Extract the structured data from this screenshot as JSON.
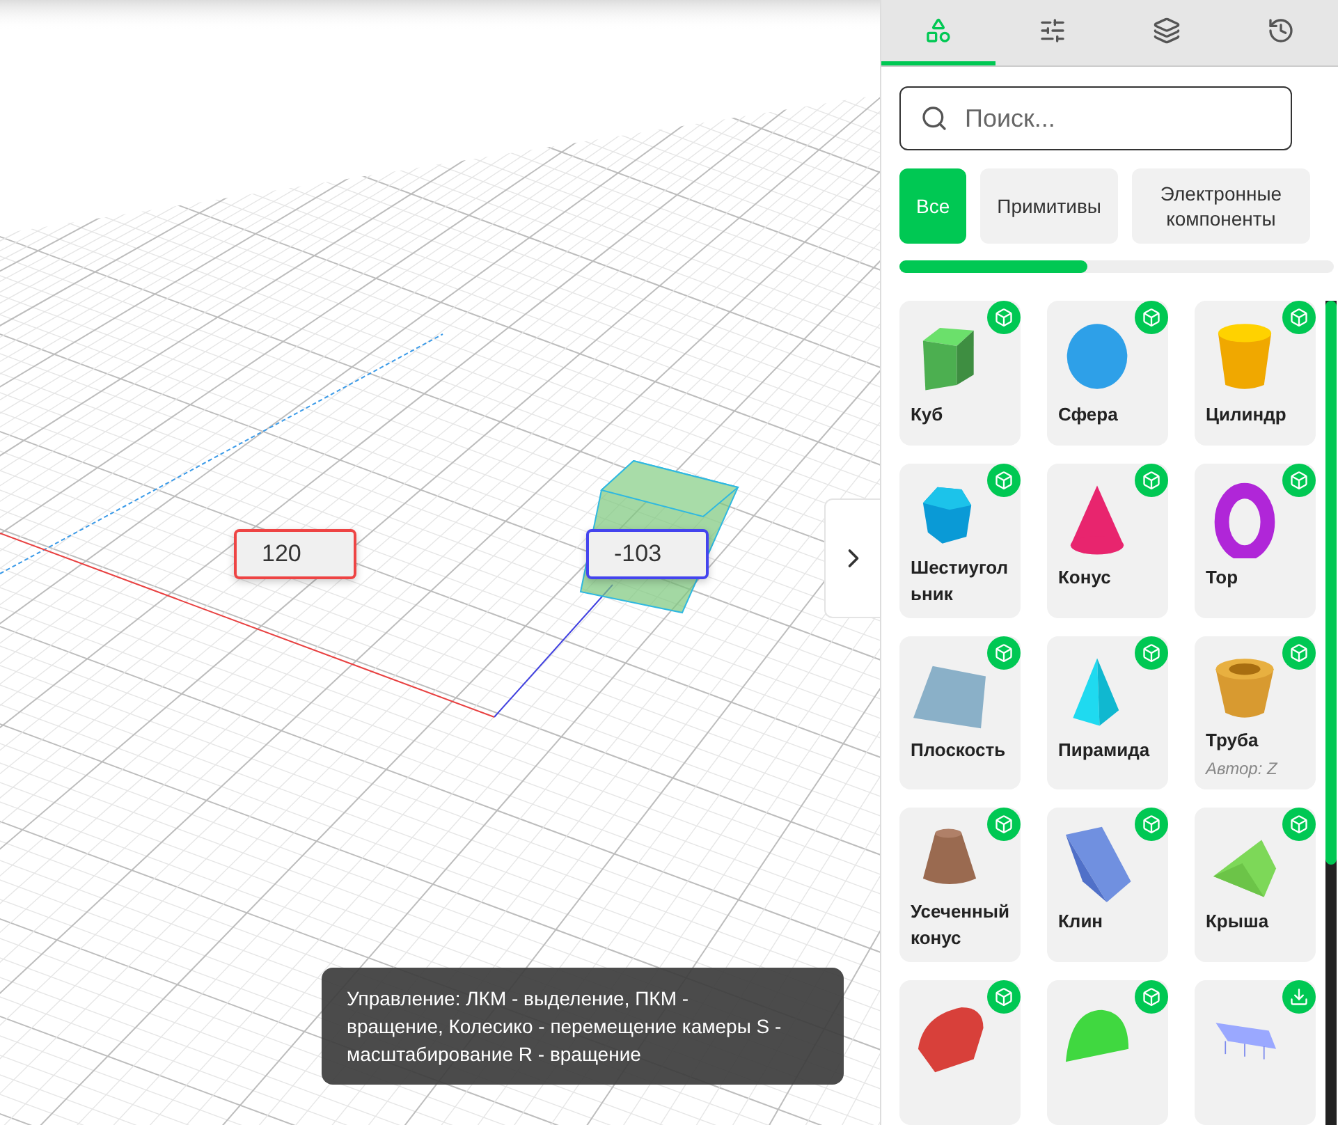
{
  "viewport": {
    "dimension_inputs": [
      {
        "value": "120",
        "color": "#ee4444"
      },
      {
        "value": "-103",
        "color": "#4444ee"
      }
    ],
    "help_tooltip": "Управление: ЛКМ - выделение, ПКМ - вращение, Колесико - перемещение камеры S - масштабирование R - вращение"
  },
  "panel": {
    "tabs": [
      {
        "selected": true
      },
      {
        "selected": false
      },
      {
        "selected": false
      },
      {
        "selected": false
      }
    ],
    "search": {
      "placeholder": "Поиск..."
    },
    "filters": [
      {
        "label": "Все",
        "selected": true
      },
      {
        "label": "Примитивы",
        "selected": false
      },
      {
        "label": "Электронные компоненты",
        "selected": false
      }
    ],
    "items": [
      {
        "label": "Куб",
        "kind": "add"
      },
      {
        "label": "Сфера",
        "kind": "add"
      },
      {
        "label": "Цилиндр",
        "kind": "add"
      },
      {
        "label": "Шестиугольник",
        "kind": "add"
      },
      {
        "label": "Конус",
        "kind": "add"
      },
      {
        "label": "Тор",
        "kind": "add"
      },
      {
        "label": "Плоскость",
        "kind": "add"
      },
      {
        "label": "Пирамида",
        "kind": "add"
      },
      {
        "label": "Труба",
        "author": "Автор: Z",
        "kind": "add"
      },
      {
        "label": "Усеченный конус",
        "kind": "add"
      },
      {
        "label": "Клин",
        "kind": "add"
      },
      {
        "label": "Крыша",
        "kind": "add"
      },
      {
        "kind": "add"
      },
      {
        "kind": "add"
      },
      {
        "kind": "download"
      }
    ]
  }
}
